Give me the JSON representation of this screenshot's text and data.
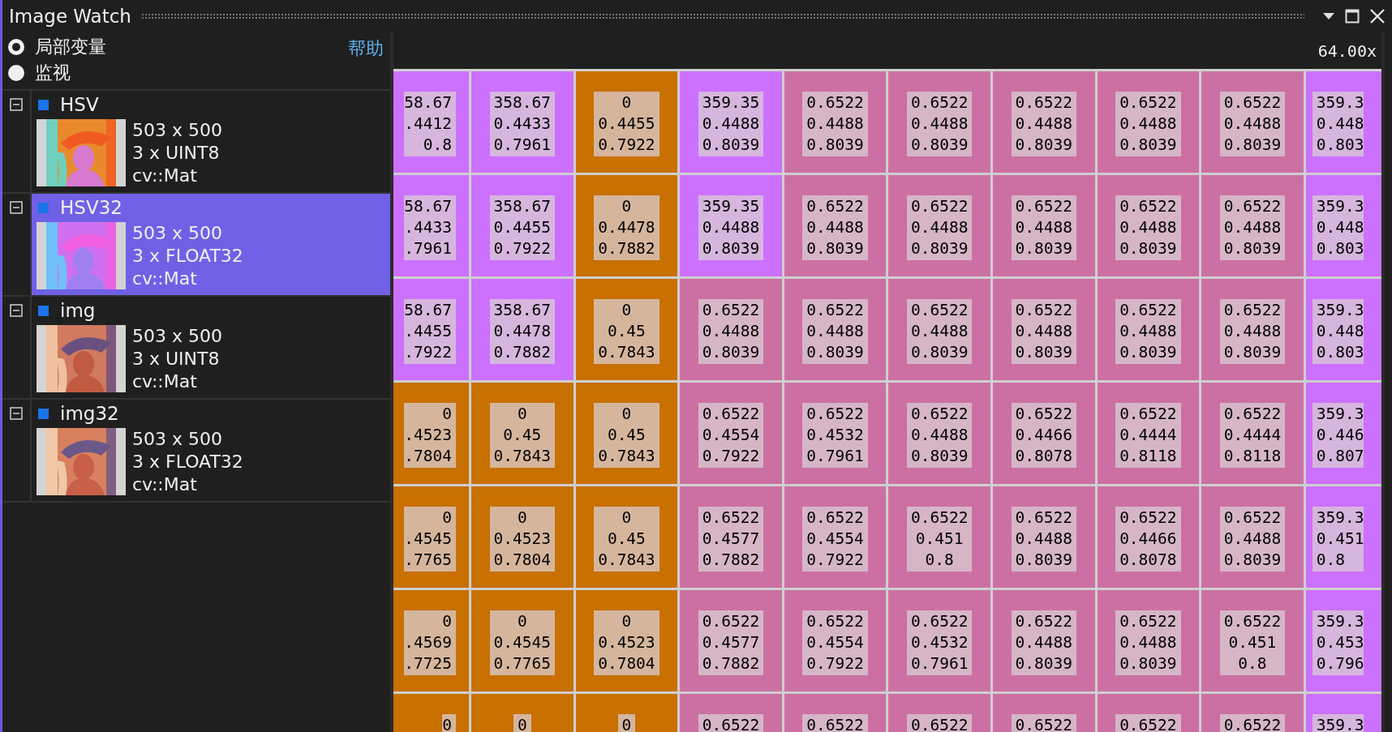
{
  "window": {
    "title": "Image Watch"
  },
  "view_options": [
    {
      "label": "局部变量",
      "selected": true
    },
    {
      "label": "监视",
      "selected": false
    }
  ],
  "help_link": "帮助",
  "zoom": "64.00x",
  "variables": [
    {
      "name": "HSV",
      "size": "503 x 500",
      "type": "3 x UINT8",
      "class": "cv::Mat",
      "selected": false,
      "expanded": true
    },
    {
      "name": "HSV32",
      "size": "503 x 500",
      "type": "3 x FLOAT32",
      "class": "cv::Mat",
      "selected": true,
      "expanded": true
    },
    {
      "name": "img",
      "size": "503 x 500",
      "type": "3 x UINT8",
      "class": "cv::Mat",
      "selected": false,
      "expanded": true
    },
    {
      "name": "img32",
      "size": "503 x 500",
      "type": "3 x FLOAT32",
      "class": "cv::Mat",
      "selected": false,
      "expanded": true
    }
  ],
  "pixel_grid": {
    "rows": [
      {
        "cells": [
          {
            "color": "#cc70ff",
            "values": [
              "58.67",
              ".4412",
              "0.8"
            ]
          },
          {
            "color": "#cc70ff",
            "values": [
              "358.67",
              "0.4433",
              "0.7961"
            ]
          },
          {
            "color": "#c87000",
            "values": [
              "0",
              "0.4455",
              "0.7922"
            ]
          },
          {
            "color": "#cc70ff",
            "values": [
              "359.35",
              "0.4488",
              "0.8039"
            ]
          },
          {
            "color": "#cc70a3",
            "values": [
              "0.6522",
              "0.4488",
              "0.8039"
            ]
          },
          {
            "color": "#cc70a3",
            "values": [
              "0.6522",
              "0.4488",
              "0.8039"
            ]
          },
          {
            "color": "#cc70a3",
            "values": [
              "0.6522",
              "0.4488",
              "0.8039"
            ]
          },
          {
            "color": "#cc70a3",
            "values": [
              "0.6522",
              "0.4488",
              "0.8039"
            ]
          },
          {
            "color": "#cc70a3",
            "values": [
              "0.6522",
              "0.4488",
              "0.8039"
            ]
          },
          {
            "color": "#cc70ff",
            "values": [
              "359.3",
              "0.448",
              "0.803"
            ]
          }
        ]
      },
      {
        "cells": [
          {
            "color": "#cc70ff",
            "values": [
              "58.67",
              ".4433",
              ".7961"
            ]
          },
          {
            "color": "#cc70ff",
            "values": [
              "358.67",
              "0.4455",
              "0.7922"
            ]
          },
          {
            "color": "#c87000",
            "values": [
              "0",
              "0.4478",
              "0.7882"
            ]
          },
          {
            "color": "#cc70ff",
            "values": [
              "359.35",
              "0.4488",
              "0.8039"
            ]
          },
          {
            "color": "#cc70a3",
            "values": [
              "0.6522",
              "0.4488",
              "0.8039"
            ]
          },
          {
            "color": "#cc70a3",
            "values": [
              "0.6522",
              "0.4488",
              "0.8039"
            ]
          },
          {
            "color": "#cc70a3",
            "values": [
              "0.6522",
              "0.4488",
              "0.8039"
            ]
          },
          {
            "color": "#cc70a3",
            "values": [
              "0.6522",
              "0.4488",
              "0.8039"
            ]
          },
          {
            "color": "#cc70a3",
            "values": [
              "0.6522",
              "0.4488",
              "0.8039"
            ]
          },
          {
            "color": "#cc70ff",
            "values": [
              "359.3",
              "0.448",
              "0.803"
            ]
          }
        ]
      },
      {
        "cells": [
          {
            "color": "#cc70ff",
            "values": [
              "58.67",
              ".4455",
              ".7922"
            ]
          },
          {
            "color": "#cc70ff",
            "values": [
              "358.67",
              "0.4478",
              "0.7882"
            ]
          },
          {
            "color": "#c87000",
            "values": [
              "0",
              "0.45",
              "0.7843"
            ]
          },
          {
            "color": "#cc70a3",
            "values": [
              "0.6522",
              "0.4488",
              "0.8039"
            ]
          },
          {
            "color": "#cc70a3",
            "values": [
              "0.6522",
              "0.4488",
              "0.8039"
            ]
          },
          {
            "color": "#cc70a3",
            "values": [
              "0.6522",
              "0.4488",
              "0.8039"
            ]
          },
          {
            "color": "#cc70a3",
            "values": [
              "0.6522",
              "0.4488",
              "0.8039"
            ]
          },
          {
            "color": "#cc70a3",
            "values": [
              "0.6522",
              "0.4488",
              "0.8039"
            ]
          },
          {
            "color": "#cc70a3",
            "values": [
              "0.6522",
              "0.4488",
              "0.8039"
            ]
          },
          {
            "color": "#cc70ff",
            "values": [
              "359.3",
              "0.448",
              "0.803"
            ]
          }
        ]
      },
      {
        "cells": [
          {
            "color": "#c87000",
            "values": [
              "0",
              ".4523",
              ".7804"
            ]
          },
          {
            "color": "#c87000",
            "values": [
              "0",
              "0.45",
              "0.7843"
            ]
          },
          {
            "color": "#c87000",
            "values": [
              "0",
              "0.45",
              "0.7843"
            ]
          },
          {
            "color": "#cc70a3",
            "values": [
              "0.6522",
              "0.4554",
              "0.7922"
            ]
          },
          {
            "color": "#cc70a3",
            "values": [
              "0.6522",
              "0.4532",
              "0.7961"
            ]
          },
          {
            "color": "#cc70a3",
            "values": [
              "0.6522",
              "0.4488",
              "0.8039"
            ]
          },
          {
            "color": "#cc70a3",
            "values": [
              "0.6522",
              "0.4466",
              "0.8078"
            ]
          },
          {
            "color": "#cc70a3",
            "values": [
              "0.6522",
              "0.4444",
              "0.8118"
            ]
          },
          {
            "color": "#cc70a3",
            "values": [
              "0.6522",
              "0.4444",
              "0.8118"
            ]
          },
          {
            "color": "#cc70ff",
            "values": [
              "359.3",
              "0.446",
              "0.807"
            ]
          }
        ]
      },
      {
        "cells": [
          {
            "color": "#c87000",
            "values": [
              "0",
              ".4545",
              ".7765"
            ]
          },
          {
            "color": "#c87000",
            "values": [
              "0",
              "0.4523",
              "0.7804"
            ]
          },
          {
            "color": "#c87000",
            "values": [
              "0",
              "0.45",
              "0.7843"
            ]
          },
          {
            "color": "#cc70a3",
            "values": [
              "0.6522",
              "0.4577",
              "0.7882"
            ]
          },
          {
            "color": "#cc70a3",
            "values": [
              "0.6522",
              "0.4554",
              "0.7922"
            ]
          },
          {
            "color": "#cc70a3",
            "values": [
              "0.6522",
              "0.451",
              "0.8"
            ]
          },
          {
            "color": "#cc70a3",
            "values": [
              "0.6522",
              "0.4488",
              "0.8039"
            ]
          },
          {
            "color": "#cc70a3",
            "values": [
              "0.6522",
              "0.4466",
              "0.8078"
            ]
          },
          {
            "color": "#cc70a3",
            "values": [
              "0.6522",
              "0.4488",
              "0.8039"
            ]
          },
          {
            "color": "#cc70ff",
            "values": [
              "359.3",
              "0.451",
              "0.8"
            ]
          }
        ]
      },
      {
        "cells": [
          {
            "color": "#c87000",
            "values": [
              "0",
              ".4569",
              ".7725"
            ]
          },
          {
            "color": "#c87000",
            "values": [
              "0",
              "0.4545",
              "0.7765"
            ]
          },
          {
            "color": "#c87000",
            "values": [
              "0",
              "0.4523",
              "0.7804"
            ]
          },
          {
            "color": "#cc70a3",
            "values": [
              "0.6522",
              "0.4577",
              "0.7882"
            ]
          },
          {
            "color": "#cc70a3",
            "values": [
              "0.6522",
              "0.4554",
              "0.7922"
            ]
          },
          {
            "color": "#cc70a3",
            "values": [
              "0.6522",
              "0.4532",
              "0.7961"
            ]
          },
          {
            "color": "#cc70a3",
            "values": [
              "0.6522",
              "0.4488",
              "0.8039"
            ]
          },
          {
            "color": "#cc70a3",
            "values": [
              "0.6522",
              "0.4488",
              "0.8039"
            ]
          },
          {
            "color": "#cc70a3",
            "values": [
              "0.6522",
              "0.451",
              "0.8"
            ]
          },
          {
            "color": "#cc70ff",
            "values": [
              "359.3",
              "0.453",
              "0.796"
            ]
          }
        ]
      },
      {
        "cells": [
          {
            "color": "#c87000",
            "values": [
              "0"
            ]
          },
          {
            "color": "#c87000",
            "values": [
              "0"
            ]
          },
          {
            "color": "#c87000",
            "values": [
              "0"
            ]
          },
          {
            "color": "#cc70a3",
            "values": [
              "0.6522"
            ]
          },
          {
            "color": "#cc70a3",
            "values": [
              "0.6522"
            ]
          },
          {
            "color": "#cc70a3",
            "values": [
              "0.6522"
            ]
          },
          {
            "color": "#cc70a3",
            "values": [
              "0.6522"
            ]
          },
          {
            "color": "#cc70a3",
            "values": [
              "0.6522"
            ]
          },
          {
            "color": "#cc70a3",
            "values": [
              "0.6522"
            ]
          },
          {
            "color": "#cc70ff",
            "values": [
              "359.3"
            ]
          }
        ]
      }
    ]
  }
}
